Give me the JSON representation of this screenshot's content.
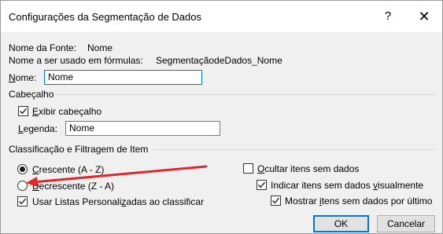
{
  "dialog": {
    "title": "Configurações da Segmentação de Dados",
    "help_label": "?",
    "close_label": "✕"
  },
  "source": {
    "name_caption": "Nome da Fonte:",
    "name_value": "Nome",
    "formula_caption": "Nome a ser usado em fórmulas:",
    "formula_value": "SegmentaçãodeDados_Nome",
    "name_field_label_u": "N",
    "name_field_label_rest": "ome:",
    "name_field_value": "Nome"
  },
  "header_section": {
    "title": "Cabeçalho",
    "show_header_u": "E",
    "show_header_rest": "xibir cabeçalho",
    "show_header_checked": true,
    "caption_label_u": "L",
    "caption_label_rest": "egenda:",
    "caption_value": "Nome"
  },
  "sort_section": {
    "title": "Classificação e Filtragem de Item",
    "ascending_u": "C",
    "ascending_rest": "rescente (A - Z)",
    "ascending_selected": true,
    "descending_u": "D",
    "descending_rest": "ecrescente (Z - A)",
    "descending_selected": false,
    "custom_lists_pre": "Usar Listas Personali",
    "custom_lists_u": "z",
    "custom_lists_post": "adas ao classificar",
    "custom_lists_checked": true,
    "hide_no_data_u": "O",
    "hide_no_data_rest": "cultar itens sem dados",
    "hide_no_data_checked": false,
    "indicate_no_data_pre": "Indicar itens sem dados ",
    "indicate_no_data_u": "v",
    "indicate_no_data_post": "isualmente",
    "indicate_no_data_checked": true,
    "show_last_pre": "Mostrar ",
    "show_last_u": "i",
    "show_last_post": "tens sem dados por último",
    "show_last_checked": true
  },
  "buttons": {
    "ok": "OK",
    "cancel": "Cancelar"
  },
  "colors": {
    "annotation_arrow": "#e3262a",
    "focus_border": "#0078d7"
  }
}
